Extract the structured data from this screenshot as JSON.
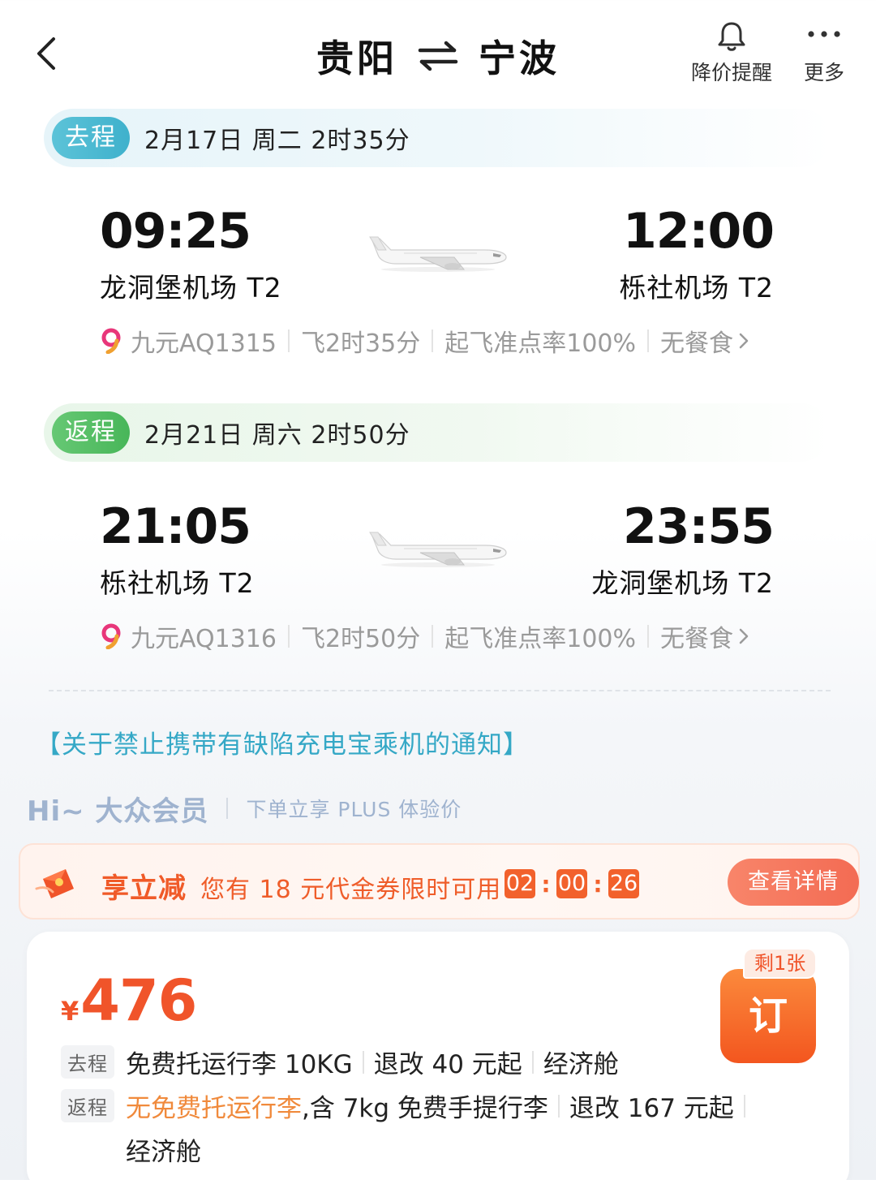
{
  "header": {
    "origin": "贵阳",
    "destination": "宁波",
    "alert_label": "降价提醒",
    "more_label": "更多"
  },
  "outbound": {
    "tag": "去程",
    "summary": "2月17日 周二  2时35分",
    "dep_time": "09:25",
    "arr_time": "12:00",
    "dep_airport": "龙洞堡机场 T2",
    "arr_airport": "栎社机场 T2",
    "flight_no": "九元AQ1315",
    "duration": "飞2时35分",
    "on_time": "起飞准点率100%",
    "meal": "无餐食"
  },
  "return": {
    "tag": "返程",
    "summary": "2月21日 周六  2时50分",
    "dep_time": "21:05",
    "arr_time": "23:55",
    "dep_airport": "栎社机场 T2",
    "arr_airport": "龙洞堡机场 T2",
    "flight_no": "九元AQ1316",
    "duration": "飞2时50分",
    "on_time": "起飞准点率100%",
    "meal": "无餐食"
  },
  "notice": "【关于禁止携带有缺陷充电宝乘机的通知】",
  "member": {
    "greeting": "Hi~ 大众会员",
    "plus_text": "下单立享 PLUS 体验价"
  },
  "coupon": {
    "title": "享立减",
    "desc": "您有 18 元代金券限时可用",
    "timer": {
      "hh": "02",
      "mm": "00",
      "ss": "26"
    },
    "detail_label": "查看详情"
  },
  "fare": {
    "currency": "¥",
    "price": "476",
    "seats_left": "剩1张",
    "book_label": "订",
    "out_tag": "去程",
    "out_baggage": "免费托运行李 10KG",
    "out_change": "退改 40 元起",
    "out_cabin": "经济舱",
    "ret_tag": "返程",
    "ret_baggage": "无免费托运行李",
    "ret_carry": ",含 7kg 免费手提行李",
    "ret_change": "退改 167 元起",
    "ret_cabin": "经济舱"
  },
  "colors": {
    "accent_orange": "#f0542a",
    "outbound_tag": "#4fbbd3",
    "return_tag": "#56bf66",
    "notice_text": "#35a8c6"
  }
}
